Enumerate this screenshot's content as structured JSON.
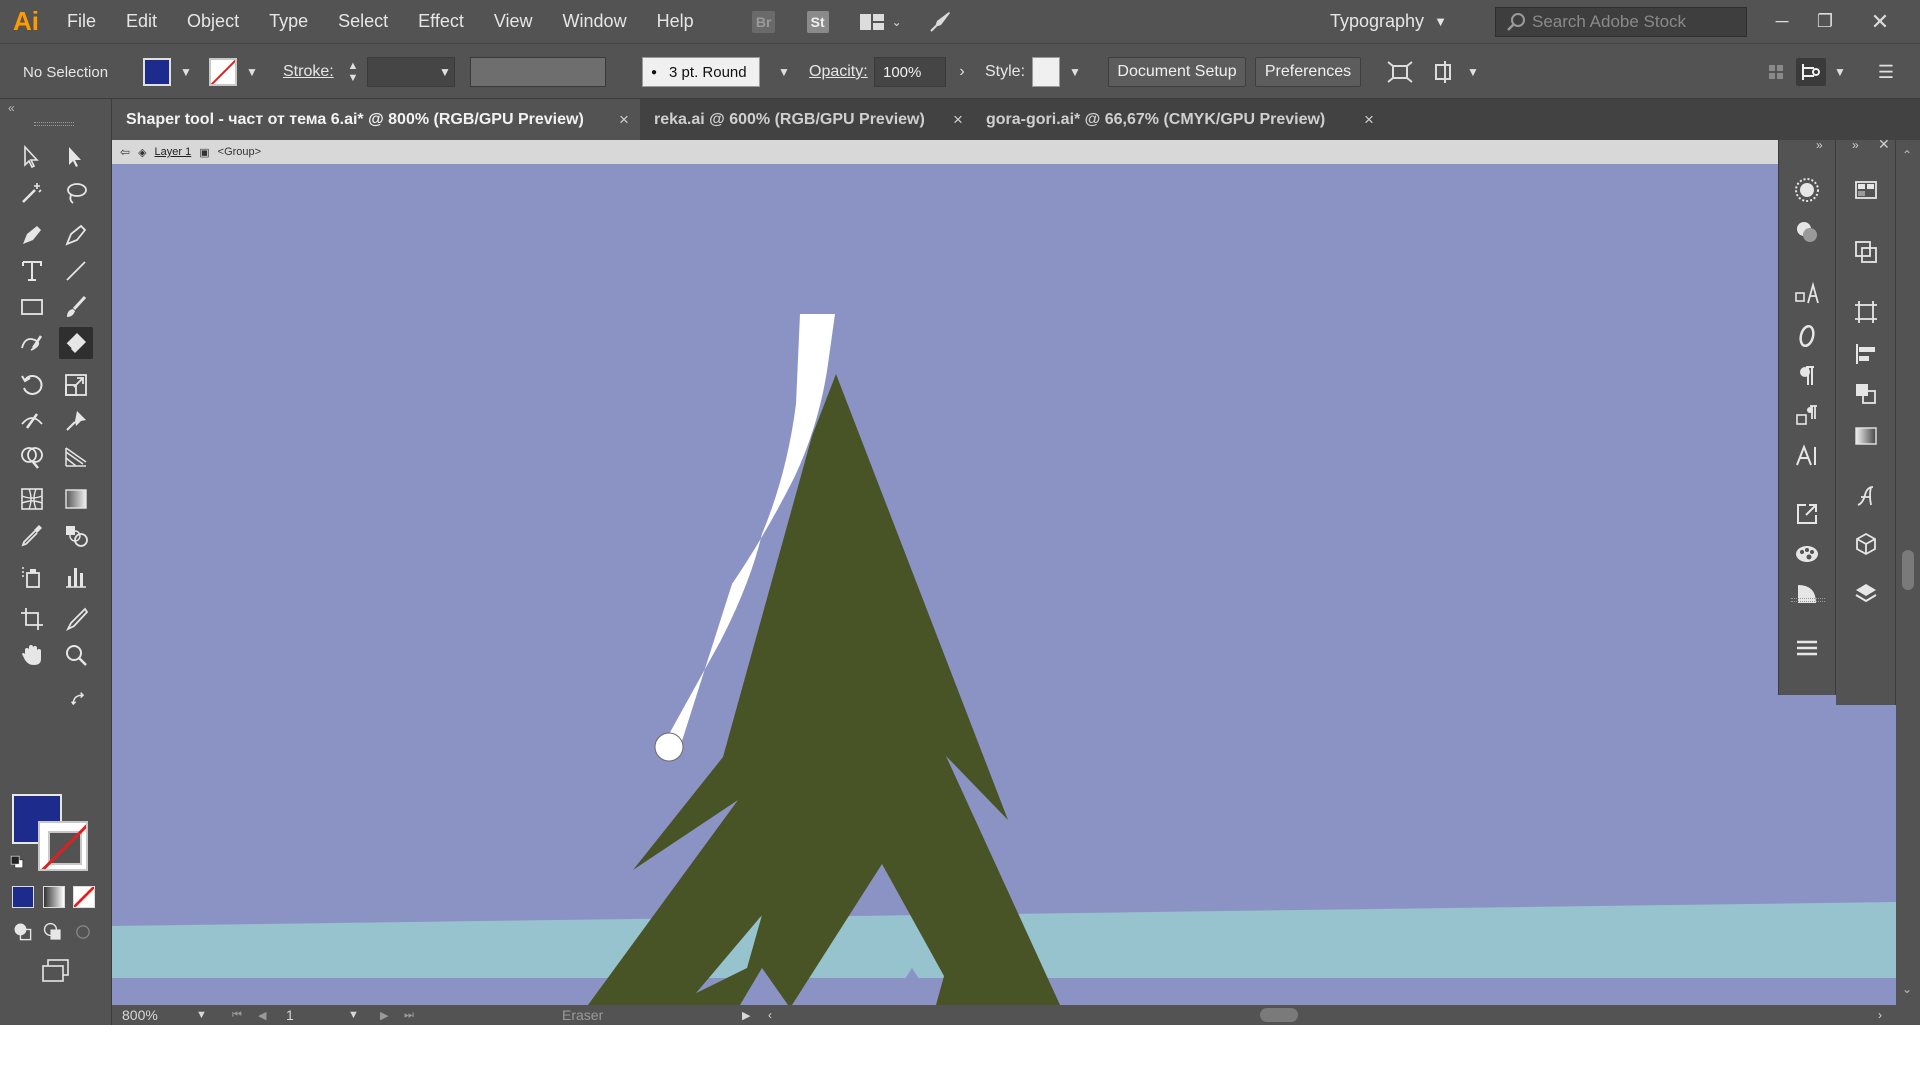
{
  "app": {
    "logo": "Ai"
  },
  "menu": [
    "File",
    "Edit",
    "Object",
    "Type",
    "Select",
    "Effect",
    "View",
    "Window",
    "Help"
  ],
  "menubar_icons": {
    "bridge": "Br",
    "stock": "St"
  },
  "workspace": {
    "label": "Typography"
  },
  "search": {
    "placeholder": "Search Adobe Stock"
  },
  "controlbar": {
    "selection": "No Selection",
    "fill_color": "#1d2b8c",
    "stroke_label": "Stroke:",
    "brush": "3 pt. Round",
    "opacity_label": "Opacity:",
    "opacity_value": "100%",
    "style_label": "Style:",
    "document_setup": "Document Setup",
    "preferences": "Preferences"
  },
  "tabs": [
    {
      "label": "Shaper tool - част от тема 6.ai* @ 800% (RGB/GPU Preview)",
      "active": true
    },
    {
      "label": "reka.ai @ 600% (RGB/GPU Preview)",
      "active": false
    },
    {
      "label": "gora-gori.ai* @ 66,67% (CMYK/GPU Preview)",
      "active": false
    }
  ],
  "breadcrumb": {
    "layer": "Layer 1",
    "group": "<Group>"
  },
  "tools": {
    "active": "eraser-tool",
    "fill_swatch": "#1d2b8c"
  },
  "canvas": {
    "background": "#8b93c4",
    "tree_color": "#485425",
    "ground_color": "#97c3ce",
    "snow_color": "#ffffff"
  },
  "statusbar": {
    "zoom": "800%",
    "artboard": "1",
    "tool": "Eraser"
  }
}
